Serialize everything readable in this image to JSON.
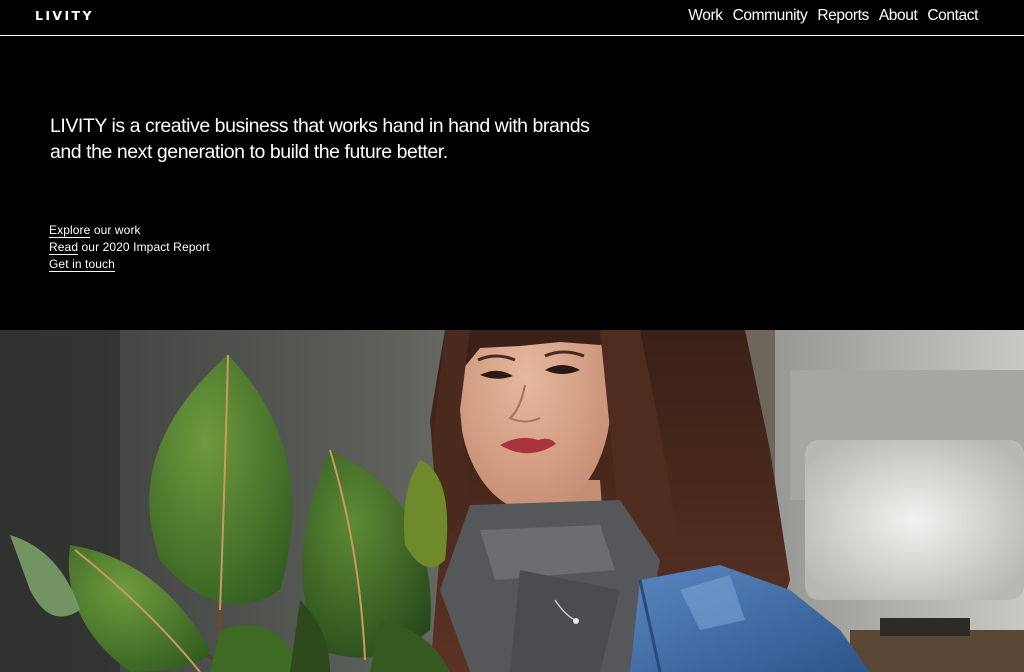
{
  "header": {
    "logo": "LIVITY",
    "nav": [
      "Work",
      "Community",
      "Reports",
      "About",
      "Contact"
    ]
  },
  "hero": {
    "tagline": "LIVITY is a creative business that works hand in hand with brands and the next generation to build the future better.",
    "links": [
      {
        "link": "Explore",
        "rest": " our work"
      },
      {
        "link": "Read",
        "rest": " our 2020 Impact Report"
      },
      {
        "link": "Get in touch",
        "rest": ""
      }
    ]
  },
  "photo": {
    "subject_icon": "portrait-photo"
  },
  "colors": {
    "background": "#000000",
    "text": "#ffffff",
    "leaf": "#4f7a2e",
    "denim": "#3d6aa8",
    "hair": "#4a2a1c"
  }
}
